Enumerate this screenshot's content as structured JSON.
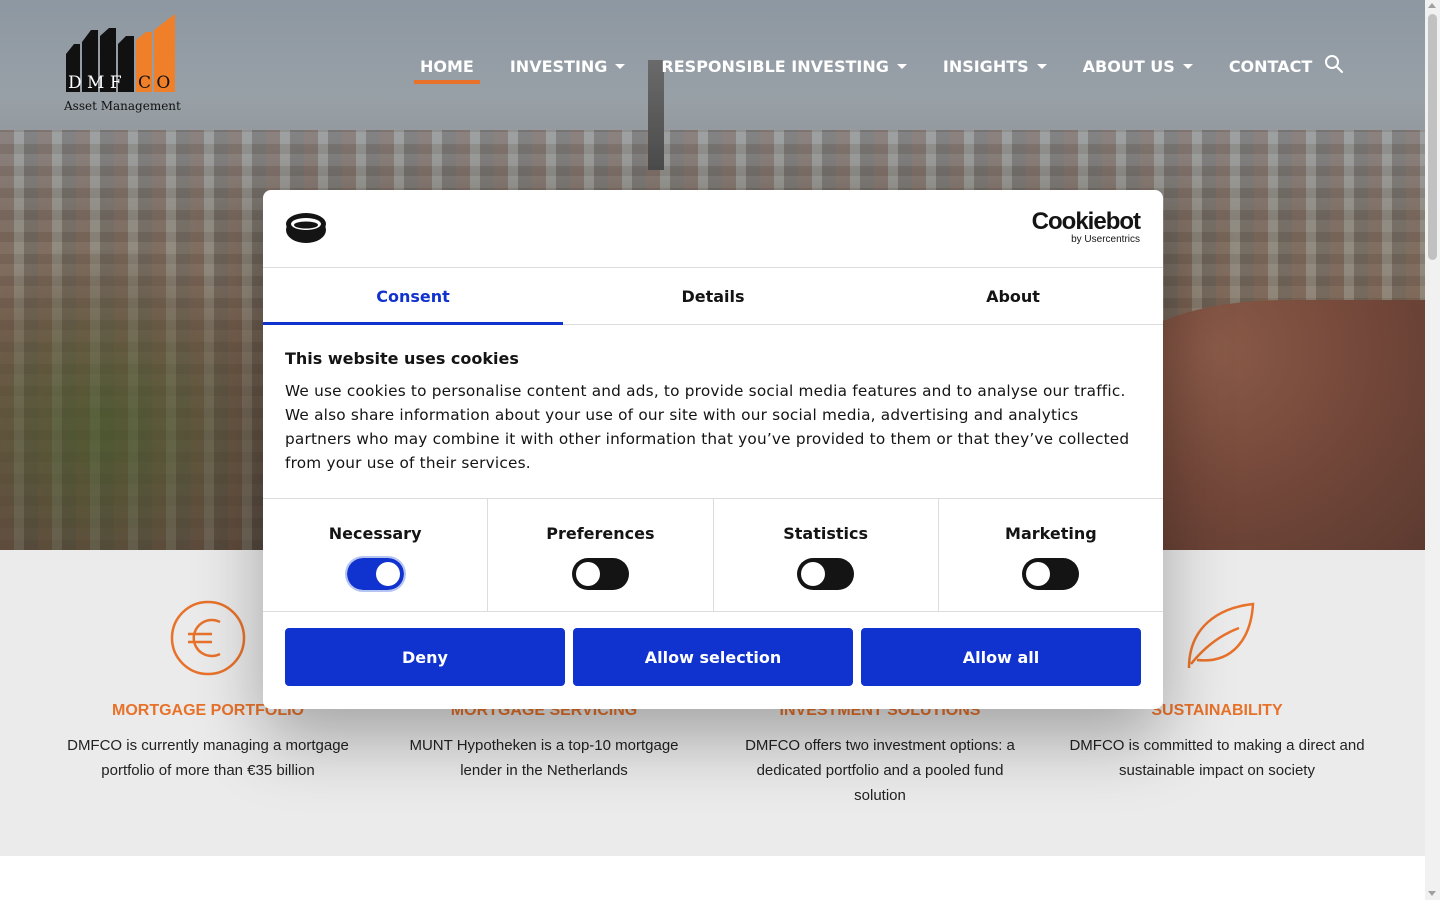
{
  "header": {
    "logo_letters": "DMFCO",
    "logo_tagline": "Asset Management",
    "nav": [
      {
        "label": "HOME",
        "active": true,
        "dropdown": false
      },
      {
        "label": "INVESTING",
        "active": false,
        "dropdown": true
      },
      {
        "label": "RESPONSIBLE INVESTING",
        "active": false,
        "dropdown": true
      },
      {
        "label": "INSIGHTS",
        "active": false,
        "dropdown": true
      },
      {
        "label": "ABOUT US",
        "active": false,
        "dropdown": true
      },
      {
        "label": "CONTACT",
        "active": false,
        "dropdown": false
      }
    ],
    "search_icon": "search-icon"
  },
  "features": [
    {
      "icon": "euro-icon",
      "title": "MORTGAGE PORTFOLIO",
      "desc": "DMFCO is currently managing a mortgage portfolio of more than €35 billion"
    },
    {
      "icon": "house-icon",
      "title": "MORTGAGE SERVICING",
      "desc": "MUNT Hypotheken is a top-10 mortgage lender in the Netherlands"
    },
    {
      "icon": "chart-icon",
      "title": "INVESTMENT SOLUTIONS",
      "desc": "DMFCO offers two investment options: a dedicated portfolio and a pooled fund solution"
    },
    {
      "icon": "leaf-icon",
      "title": "SUSTAINABILITY",
      "desc": "DMFCO is committed to making a direct and sustainable impact on society"
    }
  ],
  "cookie_dialog": {
    "brand": "Cookiebot",
    "brand_sub": "by Usercentrics",
    "tabs": [
      {
        "label": "Consent",
        "active": true
      },
      {
        "label": "Details",
        "active": false
      },
      {
        "label": "About",
        "active": false
      }
    ],
    "heading": "This website uses cookies",
    "text": "We use cookies to personalise content and ads, to provide social media features and to analyse our traffic. We also share information about your use of our site with our social media, advertising and analytics partners who may combine it with other information that you’ve provided to them or that they’ve collected from your use of their services.",
    "toggles": [
      {
        "label": "Necessary",
        "on": true
      },
      {
        "label": "Preferences",
        "on": false
      },
      {
        "label": "Statistics",
        "on": false
      },
      {
        "label": "Marketing",
        "on": false
      }
    ],
    "buttons": {
      "deny": "Deny",
      "allow_selection": "Allow selection",
      "allow_all": "Allow all"
    },
    "accent_color": "#1032cf"
  },
  "colors": {
    "brand_orange": "#e8722a"
  }
}
